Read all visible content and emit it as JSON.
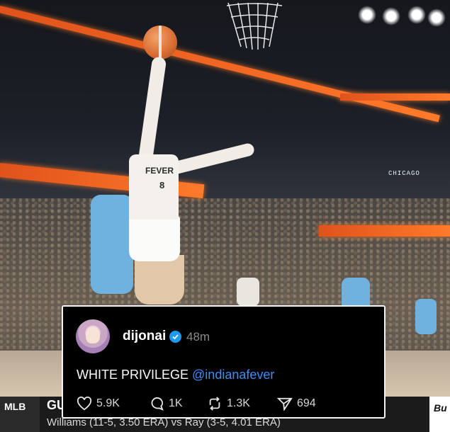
{
  "scene": {
    "player": {
      "jersey_text": "FEVER",
      "jersey_number": "8"
    },
    "arena_board": "CHICAGO"
  },
  "ticker": {
    "league": "MLB",
    "team_abbrev": "GU",
    "line": "Williams (11-5, 3.50 ERA) vs Ray (3-5, 4.01 ERA)",
    "logo_text": "Bu"
  },
  "post": {
    "username": "dijonai",
    "time": "48m",
    "text_plain": "WHITE PRIVILEGE ",
    "mention": "@indianafever",
    "stats": {
      "likes": "5.9K",
      "replies": "1K",
      "reposts": "1.3K",
      "shares": "694"
    }
  },
  "colors": {
    "mention": "#3d8ef7",
    "verified": "#1d9bf0",
    "card_bg": "#000000"
  }
}
